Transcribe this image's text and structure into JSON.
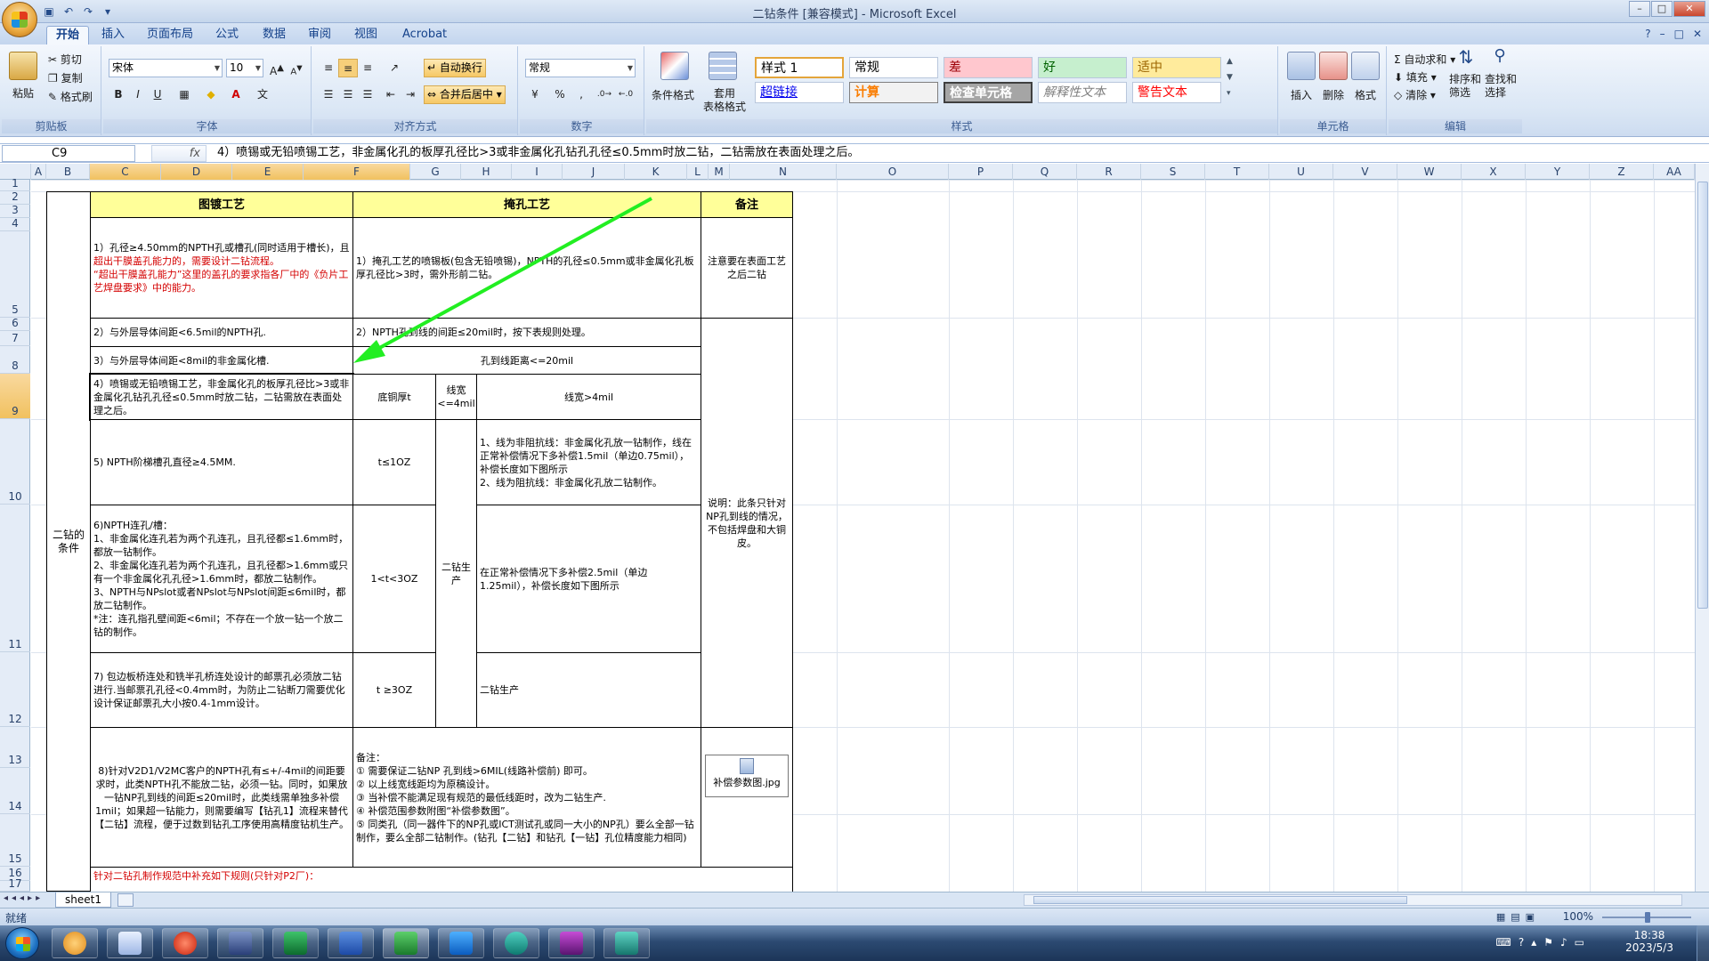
{
  "window": {
    "title": "二钻条件 [兼容模式] - Microsoft Excel",
    "controls": [
      "–",
      "□",
      "✕"
    ]
  },
  "tabs": [
    "开始",
    "插入",
    "页面布局",
    "公式",
    "数据",
    "审阅",
    "视图",
    "Acrobat"
  ],
  "ribbon": {
    "clipboard": {
      "paste": "粘贴",
      "cut": "剪切",
      "copy": "复制",
      "format_painter": "格式刷",
      "label": "剪贴板"
    },
    "font": {
      "name": "宋体",
      "size": "10",
      "bold": "B",
      "italic": "I",
      "underline": "U",
      "label": "字体"
    },
    "alignment": {
      "wrap": "自动换行",
      "merge": "合并后居中",
      "label": "对齐方式"
    },
    "number": {
      "format": "常规",
      "percent": "%",
      "comma": ",",
      "label": "数字"
    },
    "styles": {
      "conditional": "条件格式",
      "table": "套用\n表格格式",
      "cells": [
        "样式 1",
        "常规",
        "差",
        "好",
        "适中",
        "超链接",
        "计算",
        "检查单元格",
        "解释性文本",
        "警告文本"
      ],
      "label": "样式"
    },
    "cells": {
      "insert": "插入",
      "delete": "删除",
      "format": "格式",
      "label": "单元格"
    },
    "editing": {
      "autosum": "自动求和",
      "fill": "填充",
      "clear": "清除",
      "sort": "排序和\n筛选",
      "find": "查找和\n选择",
      "label": "编辑"
    }
  },
  "formula_bar": {
    "name_box": "C9",
    "fx": "fx",
    "content": "4）喷锡或无铅喷锡工艺，非金属化孔的板厚孔径比>3或非金属化孔钻孔孔径≤0.5mm时放二钻，二钻需放在表面处理之后。"
  },
  "columns": [
    "A",
    "B",
    "C",
    "D",
    "E",
    "F",
    "G",
    "H",
    "I",
    "J",
    "K",
    "L",
    "M",
    "N",
    "O",
    "P",
    "Q",
    "R",
    "S",
    "T",
    "U",
    "V",
    "W",
    "X",
    "Y",
    "Z",
    "AA"
  ],
  "rows": [
    "1",
    "2",
    "3",
    "4",
    "5",
    "6",
    "7",
    "8",
    "9",
    "10",
    "11",
    "12",
    "13",
    "14",
    "15",
    "16",
    "17"
  ],
  "table": {
    "side_label": "二钻的条件",
    "h_plating": "图镀工艺",
    "h_plug": "掩孔工艺",
    "h_note": "备注",
    "r1_plating": "1）孔径≥4.50mm的NPTH孔或槽孔(同时适用于槽长)，且",
    "r1_plating_red": "超出干膜盖孔能力的，需要设计二钻流程。",
    "r1_plating_red2": "“超出干膜盖孔能力”这里的盖孔的要求指各厂中的《负片工艺焊盘要求》中的能力。",
    "r1_plug": "1）掩孔工艺的喷锡板(包含无铅喷锡)，NPTH的孔径≤0.5mm或非金属化孔板厚孔径比>3时，需外形前二钻。",
    "r1_note": "注意要在表面工艺之后二钻",
    "r2_plating": "2）与外层导体间距<6.5mil的NPTH孔.",
    "r2_plug": "2）NPTH孔到线的间距≤20mil时，按下表规则处理。",
    "r3_plating": "3）与外层导体间距<8mil的非金属化槽.",
    "r3_plug": "孔到线距离<=20mil",
    "r4_plating": "4）喷锡或无铅喷锡工艺，非金属化孔的板厚孔径比>3或非金属化孔钻孔孔径≤0.5mm时放二钻，二钻需放在表面处理之后。",
    "r4_cu": "底铜厚t",
    "r4_lw": "线宽<=4mil",
    "r4_lw2": "线宽>4mil",
    "r5_plating": "5) NPTH阶梯槽孔直径≥4.5MM.",
    "r5_cu": "t≤1OZ",
    "r5_rule": "1、线为非阻抗线：非金属化孔放一钻制作，线在正常补偿情况下多补偿1.5mil（单边0.75mil），补偿长度如下图所示\n2、线为阻抗线：非金属化孔放二钻制作。",
    "mid_merged": "二钻生产",
    "r6_plating": "6)NPTH连孔/槽：\n1、非金属化连孔若为两个孔连孔，且孔径都≤1.6mm时，都放一钻制作。\n2、非金属化连孔若为两个孔连孔，且孔径都>1.6mm或只有一个非金属化孔孔径>1.6mm时，都放二钻制作。\n3、NPTH与NPslot或者NPslot与NPslot间距≤6mil时，都放二钻制作。\n*注：连孔指孔壁间距<6mil；不存在一个放一钻一个放二钻的制作。",
    "r6_cu": "1<t<3OZ",
    "r6_rule": "在正常补偿情况下多补偿2.5mil（单边1.25mil），补偿长度如下图所示",
    "r6_note": "说明：此条只针对NP孔到线的情况，不包括焊盘和大铜皮。",
    "r7_plating": "7) 包边板桥连处和铣半孔桥连处设计的邮票孔必须放二钻进行.当邮票孔孔径<0.4mm时，为防止二钻断刀需要优化设计保证邮票孔大小按0.4-1mm设计。",
    "r7_cu": "t ≥3OZ",
    "r7_rule": "二钻生产",
    "r8_plating": "8)针对V2D1/V2MC客户的NPTH孔有≤+/-4mil的间距要求时，此类NPTH孔不能放二钻，必须一钻。同时，如果放一钻NP孔到线的间距≤20mil时，此类线需单独多补偿1mil；如果超一钻能力，则需要编写【钻孔1】流程来替代【二钻】流程，便于过数到钻孔工序使用高精度钻机生产。",
    "r8_note": "备注：\n① 需要保证二钻NP 孔到线>6MIL(线路补偿前) 即可。\n② 以上线宽线距均为原稿设计。\n③ 当补偿不能满足现有规范的最低线距时，改为二钻生产.\n④ 补偿范围参数附图“补偿参数图”。\n⑤ 同类孔（同一器件下的NP孔或ICT测试孔或同一大小的NP孔）要么全部一钻制作，要么全部二钻制作。(钻孔【二钻】和钻孔【一钻】孔位精度能力相同)",
    "attachment": "补偿参数图.jpg",
    "r16": "针对二钻孔制作规范中补充如下规则(只针对P2厂)："
  },
  "sheet_tab": "sheet1",
  "status": {
    "ready": "就绪",
    "zoom": "100%"
  },
  "clock": {
    "time": "18:38",
    "date": "2023/5/3"
  },
  "colors": {
    "header_fill": "#ffff99",
    "arrow": "#22ee22",
    "selected_header": "#f6cf7a"
  }
}
